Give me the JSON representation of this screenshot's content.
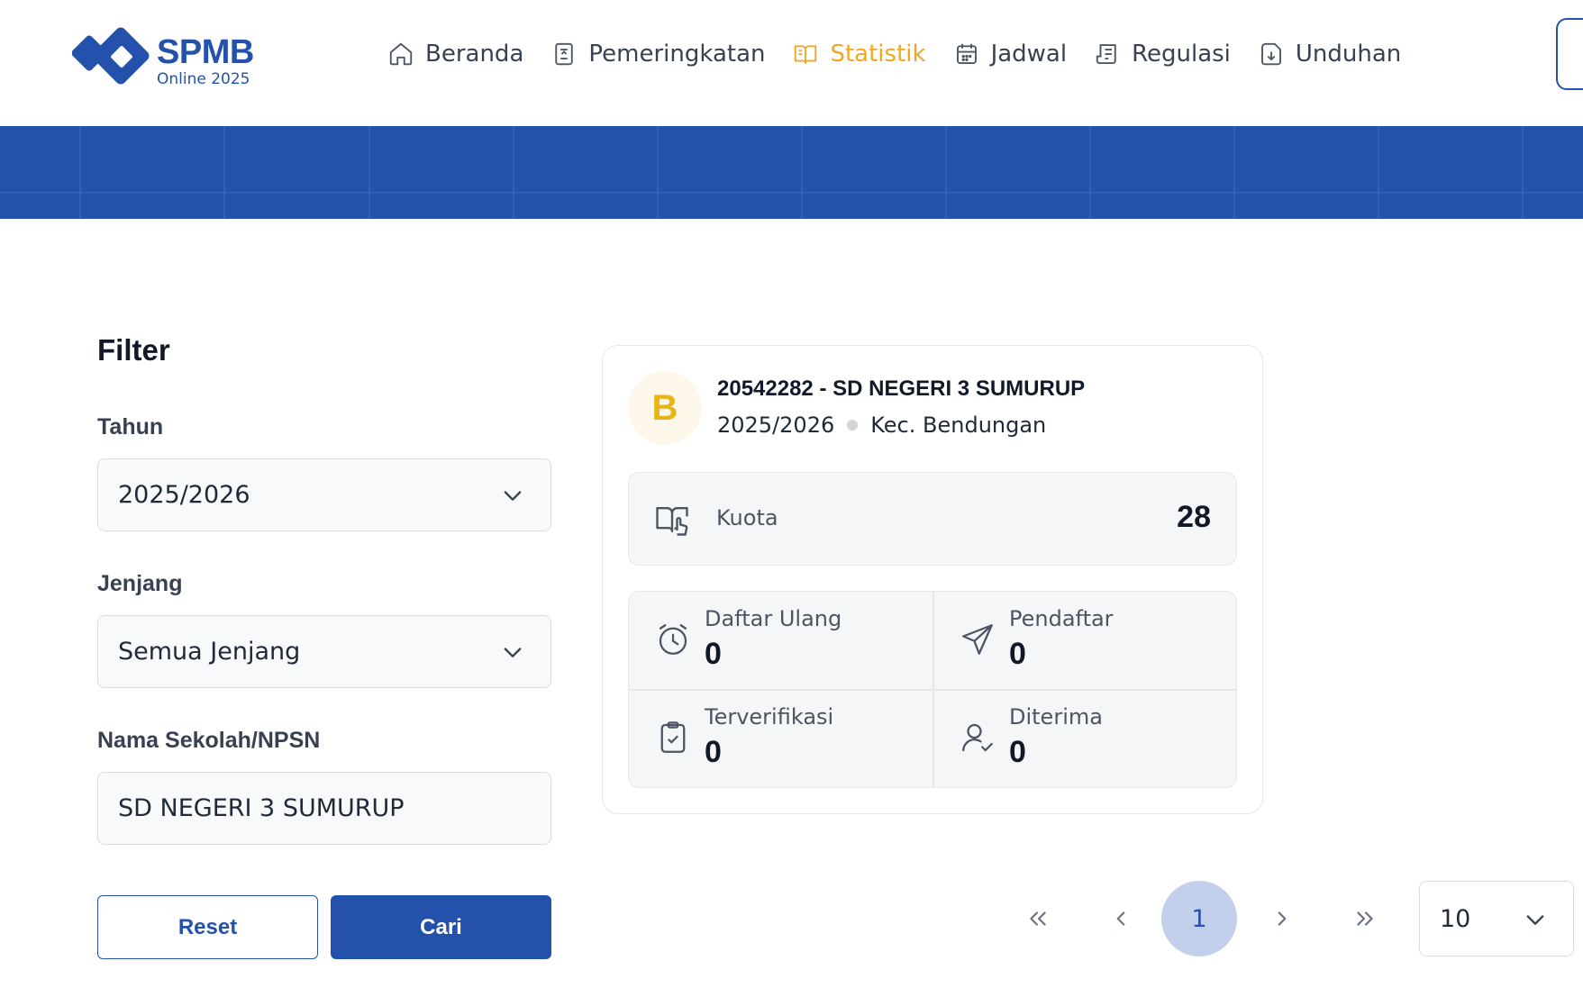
{
  "brand": {
    "title": "SPMB",
    "subtitle": "Online 2025",
    "primary_color": "#2451ab",
    "accent_color": "#f2a624"
  },
  "nav": {
    "items": [
      {
        "label": "Beranda",
        "icon": "home-icon",
        "active": false
      },
      {
        "label": "Pemeringkatan",
        "icon": "ranking-icon",
        "active": false
      },
      {
        "label": "Statistik",
        "icon": "book-open-icon",
        "active": true
      },
      {
        "label": "Jadwal",
        "icon": "calendar-icon",
        "active": false
      },
      {
        "label": "Regulasi",
        "icon": "document-icon",
        "active": false
      },
      {
        "label": "Unduhan",
        "icon": "download-icon",
        "active": false
      }
    ]
  },
  "filter": {
    "title": "Filter",
    "tahun_label": "Tahun",
    "tahun_value": "2025/2026",
    "jenjang_label": "Jenjang",
    "jenjang_value": "Semua Jenjang",
    "sekolah_label": "Nama Sekolah/NPSN",
    "sekolah_value": "SD NEGERI 3 SUMURUP",
    "reset_label": "Reset",
    "cari_label": "Cari"
  },
  "school": {
    "initial": "B",
    "name": "20542282 - SD NEGERI 3 SUMURUP",
    "year": "2025/2026",
    "district": "Kec. Bendungan",
    "kuota_label": "Kuota",
    "kuota_value": "28",
    "stats": [
      {
        "label": "Daftar Ulang",
        "value": "0",
        "icon": "alarm-clock-icon"
      },
      {
        "label": "Pendaftar",
        "value": "0",
        "icon": "send-icon"
      },
      {
        "label": "Terverifikasi",
        "value": "0",
        "icon": "clipboard-check-icon"
      },
      {
        "label": "Diterima",
        "value": "0",
        "icon": "user-check-icon"
      }
    ]
  },
  "pagination": {
    "current_page": "1",
    "per_page": "10"
  }
}
